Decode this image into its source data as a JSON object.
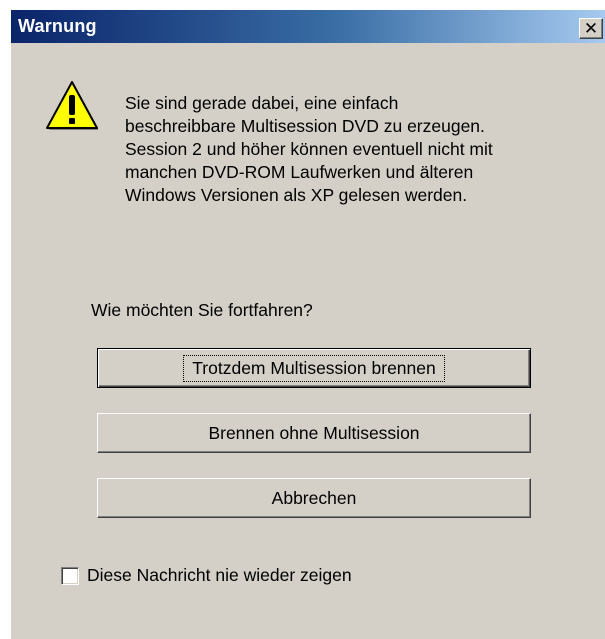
{
  "window": {
    "title": "Warnung",
    "close_glyph": "✕"
  },
  "icon": {
    "name": "warning-icon",
    "color_fill": "#ffff00",
    "glyph": "!"
  },
  "message": {
    "text": "Sie sind gerade dabei, eine einfach\nbeschreibbare Multisession DVD zu erzeugen.\nSession 2 und höher können eventuell nicht mit\nmanchen DVD-ROM Laufwerken und älteren\nWindows Versionen als XP gelesen werden."
  },
  "question": "Wie möchten Sie fortfahren?",
  "buttons": {
    "burn_multisession": "Trotzdem Multisession brennen",
    "burn_without_multisession": "Brennen ohne Multisession",
    "cancel": "Abbrechen"
  },
  "checkbox": {
    "label": "Diese Nachricht nie wieder zeigen",
    "checked": false
  },
  "colors": {
    "titlebar_start": "#0a246a",
    "titlebar_end": "#a6caf0",
    "face": "#d4d0c8"
  }
}
